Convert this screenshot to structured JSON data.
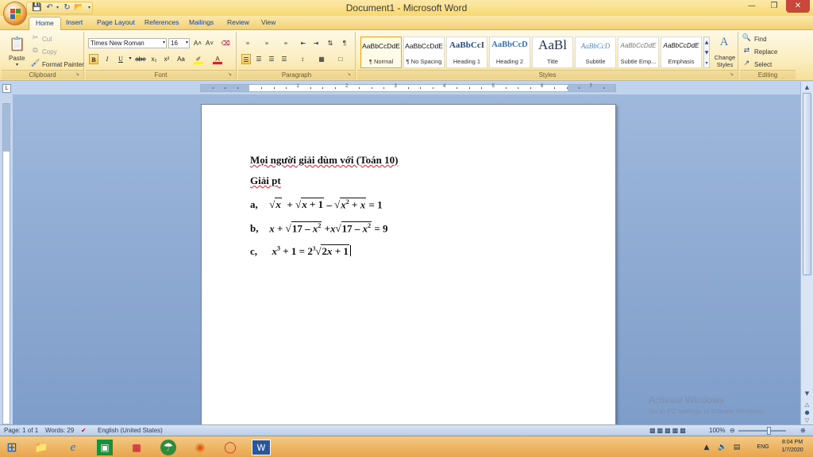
{
  "window": {
    "title": "Document1 - Microsoft Word",
    "minimize": "—",
    "restore": "❐",
    "close": "✕"
  },
  "tabs": [
    "Home",
    "Insert",
    "Page Layout",
    "References",
    "Mailings",
    "Review",
    "View"
  ],
  "clipboard": {
    "paste": "Paste",
    "cut": "Cut",
    "copy": "Copy",
    "format_painter": "Format Painter",
    "label": "Clipboard"
  },
  "font": {
    "name": "Times New Roman",
    "size": "16",
    "label": "Font",
    "bold": "B",
    "italic": "I",
    "underline": "U",
    "strike": "abe",
    "sub": "x₂",
    "sup": "x²",
    "case": "Aa",
    "grow": "A˄",
    "shrink": "A˅"
  },
  "paragraph": {
    "label": "Paragraph",
    "pilcrow": "¶"
  },
  "styles": {
    "label": "Styles",
    "items": [
      {
        "preview": "AaBbCcDdE",
        "name": "¶ Normal"
      },
      {
        "preview": "AaBbCcDdE",
        "name": "¶ No Spacing"
      },
      {
        "preview": "AaBbCcI",
        "name": "Heading 1"
      },
      {
        "preview": "AaBbCcD",
        "name": "Heading 2"
      },
      {
        "preview": "AaBl",
        "name": "Title"
      },
      {
        "preview": "AaBbCcD",
        "name": "Subtitle"
      },
      {
        "preview": "AaBbCcDdE",
        "name": "Subtle Emp..."
      },
      {
        "preview": "AaBbCcDdE",
        "name": "Emphasis"
      }
    ],
    "change": "Change Styles"
  },
  "editing": {
    "label": "Editing",
    "find": "Find",
    "replace": "Replace",
    "select": "Select"
  },
  "document": {
    "line1": "Mọi người giải dùm với (Toán 10)",
    "line2": "Giải pt",
    "a": {
      "label": "a,",
      "eq": "= 1"
    },
    "b": {
      "label": "b,",
      "eq": "= 9"
    },
    "c": {
      "label": "c,",
      "eq": "= 2"
    }
  },
  "status": {
    "page": "Page: 1 of 1",
    "words": "Words: 29",
    "language": "English (United States)",
    "zoom": "100%"
  },
  "watermark": {
    "line1": "Activate Windows",
    "line2": "Go to PC settings to activate Windows."
  },
  "taskbar": {
    "lang": "ENG",
    "time": "8:04 PM",
    "date": "1/7/2020"
  },
  "colors": {
    "accent": "#15428b",
    "taskbar": "#e8a54b",
    "ribbon": "#fbedbe"
  }
}
